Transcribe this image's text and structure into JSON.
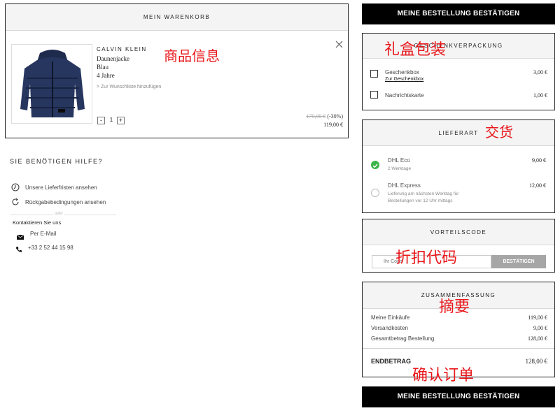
{
  "cart": {
    "title": "MEIN WARENKORB",
    "product": {
      "brand": "CALVIN KLEIN",
      "name": "Daunenjacke",
      "color": "Blau",
      "size": "4 Jahre",
      "wishlist": "> Zur Wunschliste hinzufügen",
      "qty_minus": "-",
      "qty": "1",
      "qty_plus": "+",
      "old_price": "170,00 €",
      "discount": "(-30%)",
      "price": "119,00 €"
    },
    "close_icon": "close-icon",
    "annotation": "商品信息"
  },
  "help": {
    "title": "SIE BENÖTIGEN HILFE?",
    "delivery_link": "Unsere Lieferfristen ansehen",
    "returns_link": "Rückgabebedingungen ansehen",
    "divider_text": "oder",
    "contact_title": "Kontaktieren Sie uns",
    "email": "Per E-Mail",
    "phone": "+33 2 52 44 15 98"
  },
  "confirm_top": {
    "label": "MEINE BESTELLUNG BESTÄTIGEN"
  },
  "gift": {
    "title": "GESCHENKVERPACKUNG",
    "annotation": "礼盒包装",
    "items": [
      {
        "label": "Geschenkbox",
        "link": "Zur Geschenkbox",
        "price": "3,00 €"
      },
      {
        "label": "Nachrichtskarte",
        "price": "1,00 €"
      }
    ]
  },
  "delivery": {
    "title": "LIEFERART",
    "annotation": "交货",
    "options": [
      {
        "name": "DHL Eco",
        "desc": "2 Werktage",
        "price": "9,00 €",
        "selected": true
      },
      {
        "name": "DHL Express",
        "desc_line1": "Lieferung am nächsten Werktag für",
        "desc_line2": "Bestellungen vor 12 Uhr mittags",
        "price": "12,00 €",
        "selected": false
      }
    ]
  },
  "voucher": {
    "title": "VORTEILSCODE",
    "annotation": "折扣代码",
    "placeholder": "Ihr Code",
    "button": "BESTÄTIGEN"
  },
  "summary": {
    "title": "ZUSAMMENFASSUNG",
    "annotation": "摘要",
    "rows": [
      {
        "label": "Meine Einkäufe",
        "value": "119,00 €"
      },
      {
        "label": "Versandkosten",
        "value": "9,00 €"
      },
      {
        "label": "Gesamtbetrag Bestellung",
        "value": "128,00 €"
      }
    ],
    "total_label": "ENDBETRAG",
    "total_value": "128,00 €"
  },
  "confirm_bottom": {
    "annotation": "确认订单",
    "label": "MEINE BESTELLUNG BESTÄTIGEN"
  },
  "colors": {
    "accent_check": "#3cb54a",
    "annotation_red": "#e8171b",
    "button_black": "#000000"
  }
}
